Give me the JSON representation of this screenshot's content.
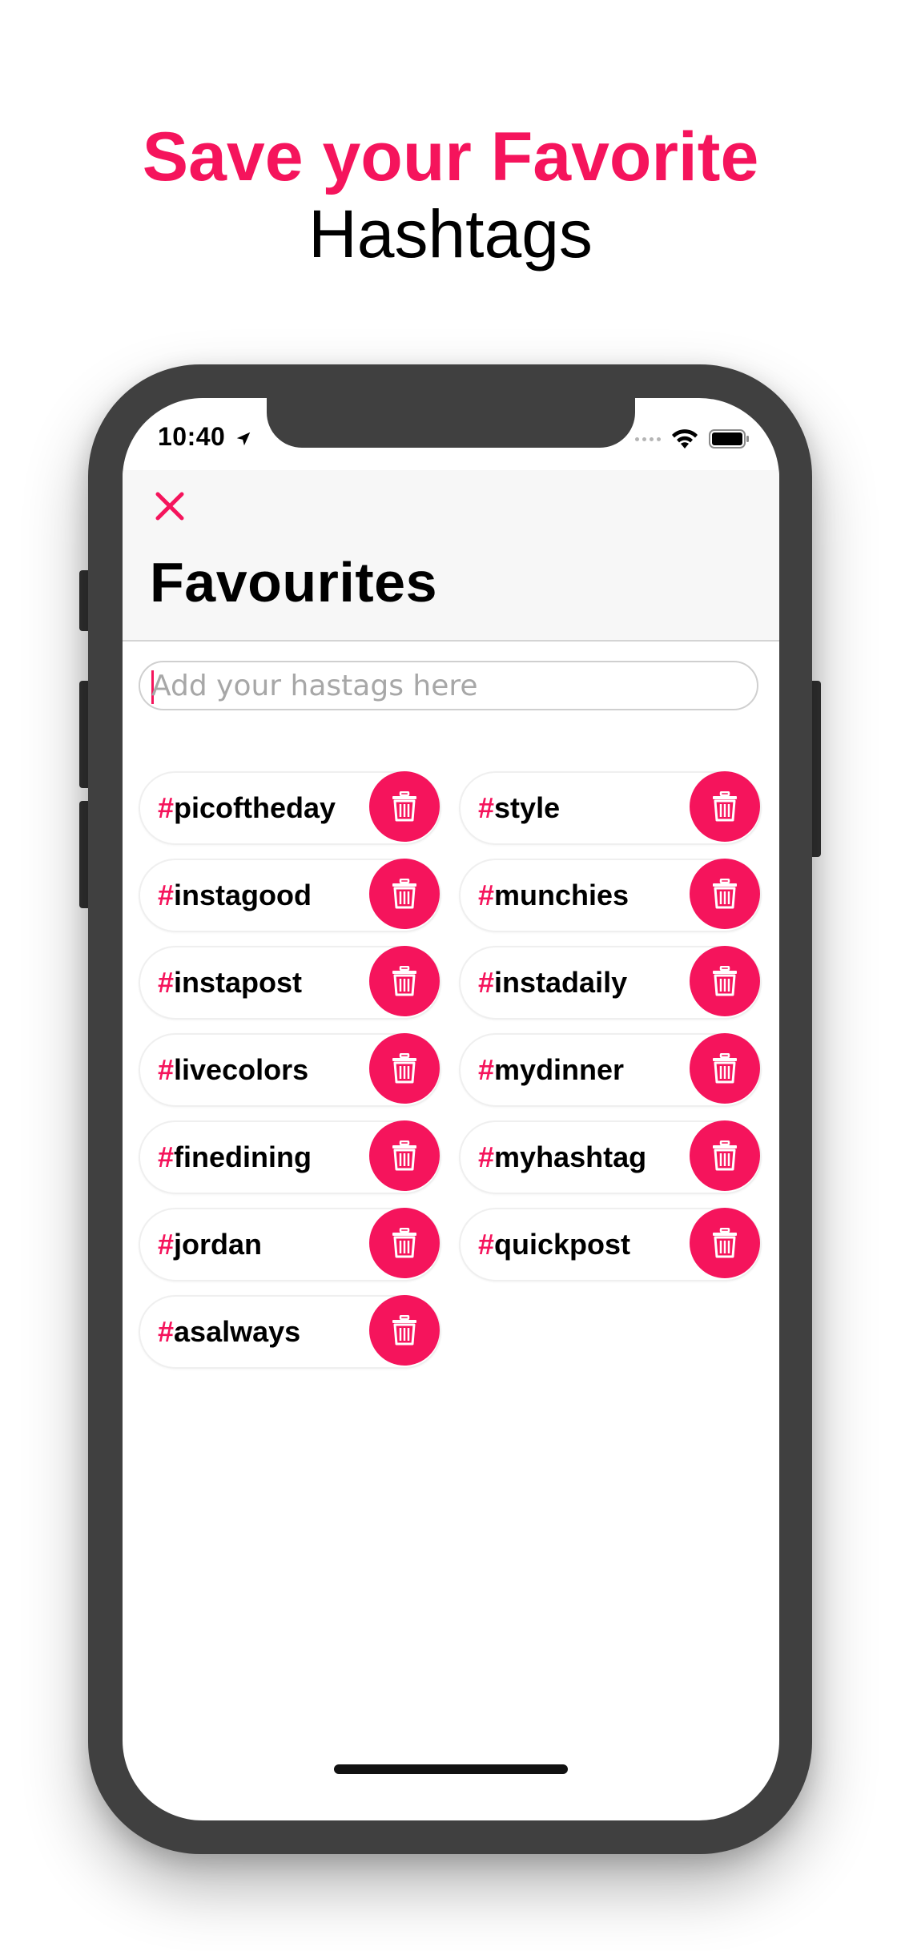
{
  "headline": {
    "accent": "Save your Favorite",
    "plain": "Hashtags"
  },
  "status_bar": {
    "time": "10:40",
    "icons": [
      "location-arrow-icon",
      "signal-dots-icon",
      "wifi-icon",
      "battery-icon"
    ]
  },
  "nav": {
    "close_icon": "close-icon",
    "title": "Favourites"
  },
  "search": {
    "placeholder": "Add your hastags here",
    "value": ""
  },
  "hashtags": [
    {
      "prefix": "#",
      "tag": "picoftheday"
    },
    {
      "prefix": "#",
      "tag": "style"
    },
    {
      "prefix": "#",
      "tag": "instagood"
    },
    {
      "prefix": "#",
      "tag": "munchies"
    },
    {
      "prefix": "#",
      "tag": "instapost"
    },
    {
      "prefix": "#",
      "tag": "instadaily"
    },
    {
      "prefix": "#",
      "tag": "livecolors"
    },
    {
      "prefix": "#",
      "tag": "mydinner"
    },
    {
      "prefix": "#",
      "tag": "finedining"
    },
    {
      "prefix": "#",
      "tag": "myhashtag"
    },
    {
      "prefix": "#",
      "tag": "jordan"
    },
    {
      "prefix": "#",
      "tag": "quickpost"
    },
    {
      "prefix": "#",
      "tag": "asalways"
    }
  ],
  "delete_icon": "trash-icon",
  "colors": {
    "accent": "#f5145c",
    "phone_frame": "#404040",
    "nav_background": "#f7f7f7"
  }
}
